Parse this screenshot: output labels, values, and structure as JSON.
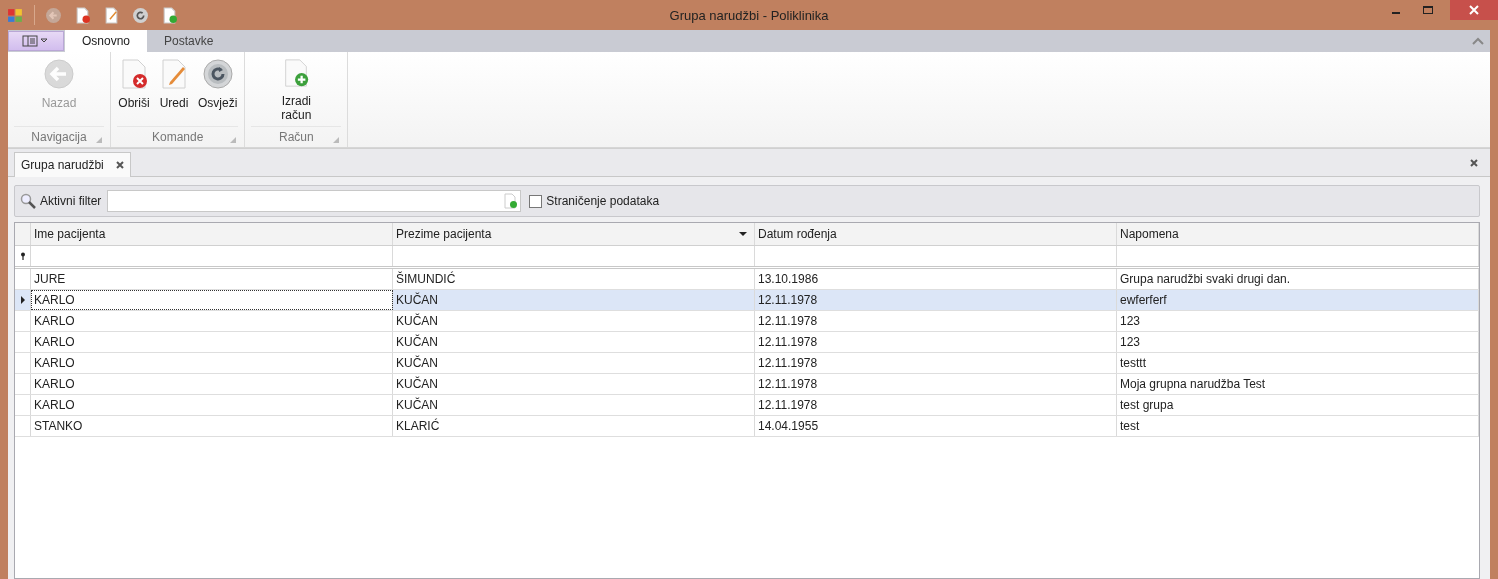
{
  "window": {
    "title": "Grupa narudžbi - Poliklinika",
    "quick_access": [
      {
        "kind": "back",
        "disabled": true
      },
      {
        "kind": "delete",
        "disabled": false
      },
      {
        "kind": "edit",
        "disabled": false
      },
      {
        "kind": "refresh",
        "disabled": false
      },
      {
        "kind": "add",
        "disabled": false
      }
    ]
  },
  "ribbon": {
    "tabs": [
      {
        "label": "Osnovno",
        "selected": true
      },
      {
        "label": "Postavke",
        "selected": false
      }
    ],
    "groups": [
      {
        "label": "Navigacija",
        "buttons": [
          {
            "label": "Nazad",
            "kind": "back",
            "disabled": true
          }
        ]
      },
      {
        "label": "Komande",
        "buttons": [
          {
            "label": "Obriši",
            "kind": "delete",
            "disabled": false
          },
          {
            "label": "Uredi",
            "kind": "edit",
            "disabled": false
          },
          {
            "label": "Osvježi",
            "kind": "refresh",
            "disabled": false
          }
        ]
      },
      {
        "label": "Račun",
        "buttons": [
          {
            "label": "Izradi račun",
            "kind": "add",
            "disabled": false
          }
        ]
      }
    ]
  },
  "document_tabs": [
    {
      "label": "Grupa narudžbi",
      "selected": true
    }
  ],
  "filter": {
    "label": "Aktivni filter",
    "paging": {
      "label": "Straničenje podataka",
      "checked": false
    }
  },
  "table": {
    "columns": [
      {
        "label": "Ime pacijenta",
        "dropdown": false
      },
      {
        "label": "Prezime pacijenta",
        "dropdown": true
      },
      {
        "label": "Datum rođenja",
        "dropdown": false
      },
      {
        "label": "Napomena",
        "dropdown": false
      }
    ],
    "rows": [
      {
        "cells": [
          "JURE",
          "ŠIMUNDIĆ",
          "13.10.1986",
          "Grupa narudžbi svaki drugi dan."
        ],
        "selected": false
      },
      {
        "cells": [
          "KARLO",
          "KUČAN",
          "12.11.1978",
          "ewferferf"
        ],
        "selected": true
      },
      {
        "cells": [
          "KARLO",
          "KUČAN",
          "12.11.1978",
          "123"
        ],
        "selected": false
      },
      {
        "cells": [
          "KARLO",
          "KUČAN",
          "12.11.1978",
          "123"
        ],
        "selected": false
      },
      {
        "cells": [
          "KARLO",
          "KUČAN",
          "12.11.1978",
          "testtt"
        ],
        "selected": false
      },
      {
        "cells": [
          "KARLO",
          "KUČAN",
          "12.11.1978",
          "Moja grupna narudžba Test"
        ],
        "selected": false
      },
      {
        "cells": [
          "KARLO",
          "KUČAN",
          "12.11.1978",
          "test grupa"
        ],
        "selected": false
      },
      {
        "cells": [
          "STANKO",
          "KLARIĆ",
          "14.04.1955",
          "test"
        ],
        "selected": false
      }
    ]
  }
}
